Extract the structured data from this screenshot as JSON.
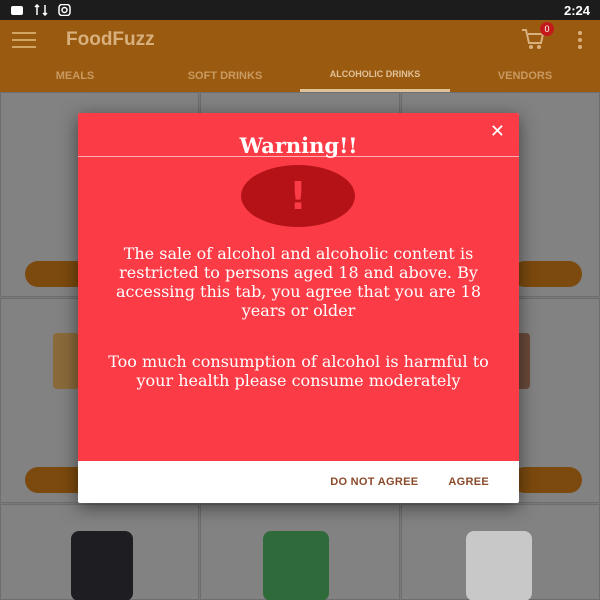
{
  "status_bar": {
    "time": "2:24"
  },
  "app_bar": {
    "title": "FoodFuzz",
    "cart_count": "0"
  },
  "tabs": [
    {
      "label": "MEALS"
    },
    {
      "label": "SOFT DRINKS"
    },
    {
      "label": "ALCOHOLIC DRINKS"
    },
    {
      "label": "VENDORS"
    }
  ],
  "dialog": {
    "title": "Warning!!",
    "icon": "exclamation-icon",
    "message_1": "The sale of alcohol and alcoholic content is restricted to persons aged 18 and above. By accessing this tab, you agree that you are 18 years or older",
    "message_2": "Too much consumption of alcohol is harmful to your health please consume moderately",
    "disagree_label": "DO NOT AGREE",
    "agree_label": "AGREE"
  },
  "colors": {
    "app_bar": "#9a5a0f",
    "dialog_red": "#fb3c47",
    "warning_circle": "#b51218"
  }
}
